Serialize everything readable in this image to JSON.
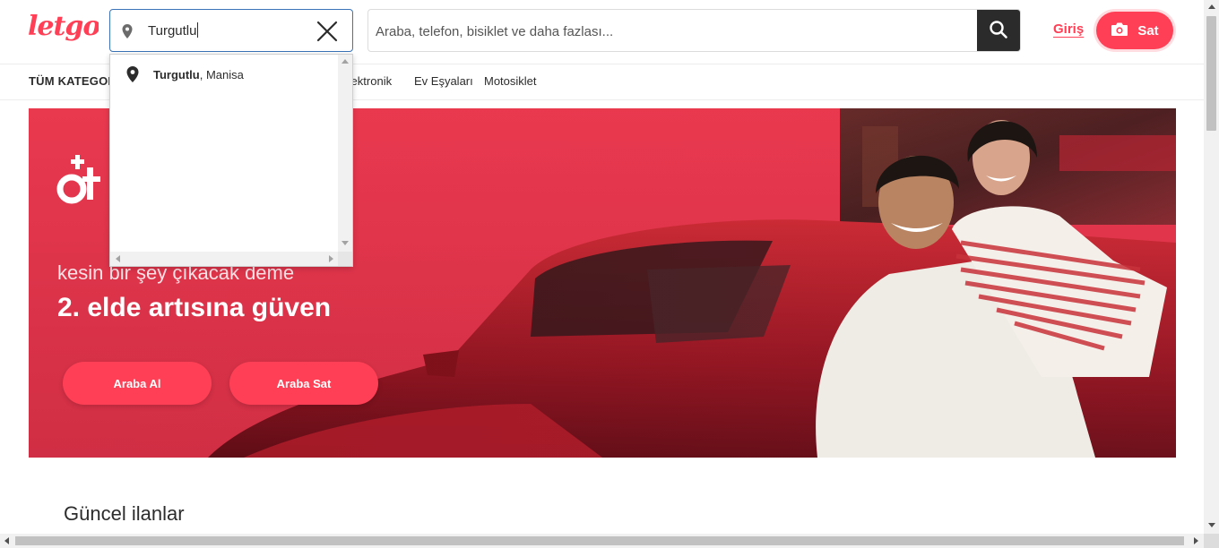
{
  "brand": {
    "logo_text": "letgo",
    "accent": "#ff3f55"
  },
  "header": {
    "location_value": "Turgutlu",
    "search_placeholder": "Araba, telefon, bisiklet ve daha fazlası...",
    "login_label": "Giriş",
    "sell_label": "Sat"
  },
  "categories": {
    "all_label": "TÜM KATEGORİLER",
    "items": [
      "Elektronik",
      "Ev Eşyaları",
      "Motosiklet"
    ]
  },
  "location_dropdown": {
    "suggestions": [
      {
        "primary": "Turgutlu",
        "secondary": ", Manisa"
      }
    ]
  },
  "hero": {
    "brand_logo_text": "otc",
    "subtitle": "kesin bir şey çıkacak deme",
    "title": "2. elde artısına güven",
    "buttons": [
      "Araba Al",
      "Araba Sat"
    ]
  },
  "section": {
    "title": "Güncel ilanlar"
  },
  "icons": {
    "location": "map-pin-icon",
    "clear": "close-icon",
    "search": "search-icon",
    "camera": "camera-icon"
  }
}
